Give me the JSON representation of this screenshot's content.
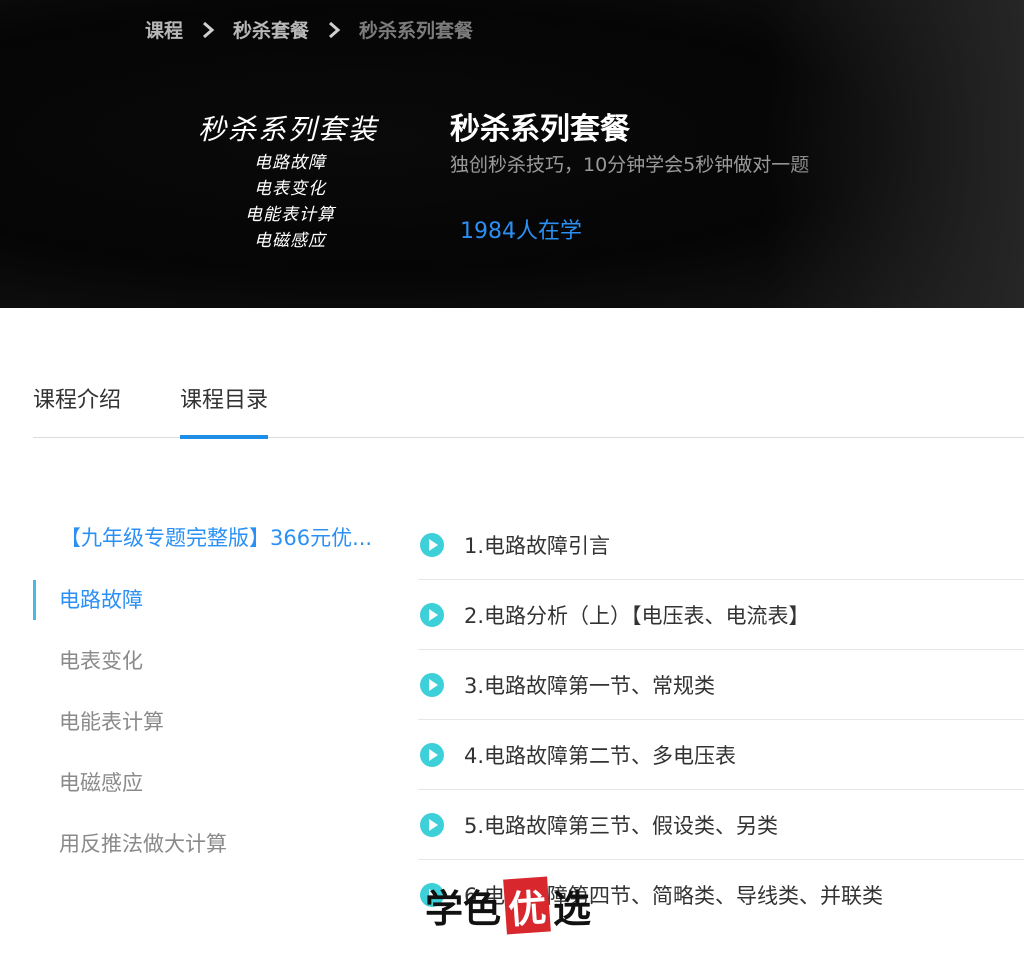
{
  "breadcrumb": {
    "items": [
      "课程",
      "秒杀套餐",
      "秒杀系列套餐"
    ]
  },
  "cover": {
    "title": "秒杀系列套装",
    "lines": [
      "电路故障",
      "电表变化",
      "电能表计算",
      "电磁感应"
    ]
  },
  "course": {
    "title": "秒杀系列套餐",
    "subtitle": "独创秒杀技巧，10分钟学会5秒钟做对一题",
    "learners": "1984人在学"
  },
  "tabs": [
    {
      "label": "课程介绍",
      "active": false
    },
    {
      "label": "课程目录",
      "active": true
    }
  ],
  "sidebar": {
    "package": "【九年级专题完整版】366元优...",
    "items": [
      {
        "label": "电路故障",
        "active": true
      },
      {
        "label": "电表变化",
        "active": false
      },
      {
        "label": "电能表计算",
        "active": false
      },
      {
        "label": "电磁感应",
        "active": false
      },
      {
        "label": "用反推法做大计算",
        "active": false
      }
    ]
  },
  "lessons": [
    {
      "label": "1.电路故障引言",
      "icon": "play-icon"
    },
    {
      "label": "2.电路分析（上）【电压表、电流表】",
      "icon": "play-icon"
    },
    {
      "label": "3.电路故障第一节、常规类",
      "icon": "play-icon"
    },
    {
      "label": "4.电路故障第二节、多电压表",
      "icon": "play-icon"
    },
    {
      "label": "5.电路故障第三节、假设类、另类",
      "icon": "play-icon"
    },
    {
      "label": "6.电路故障第四节、简略类、导线类、并联类",
      "icon": "play-icon"
    }
  ],
  "watermark": {
    "chars": [
      "学",
      "色",
      "优",
      "选"
    ]
  },
  "colors": {
    "accent": "#2b90f5",
    "tab_underline": "#1f8ee6",
    "play": "#3ed0d8",
    "seal": "#d9272e"
  }
}
